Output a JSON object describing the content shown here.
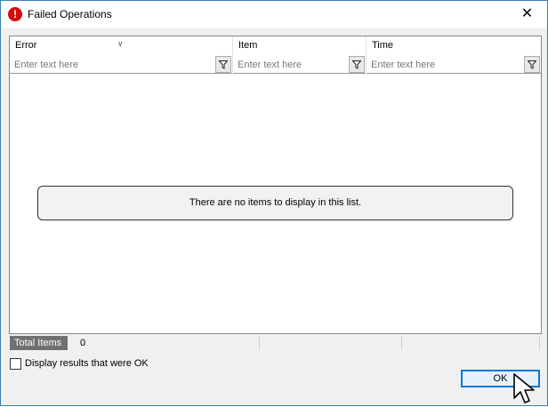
{
  "window": {
    "title": "Failed Operations",
    "title_icon": "error-icon",
    "close_glyph": "✕"
  },
  "grid": {
    "columns": [
      {
        "header": "Error",
        "placeholder": "Enter text here",
        "sorted": true
      },
      {
        "header": "Item",
        "placeholder": "Enter text here"
      },
      {
        "header": "Time",
        "placeholder": "Enter text here"
      }
    ],
    "empty_message": "There are no items to display in this list."
  },
  "status": {
    "total_label": "Total Items",
    "total_value": "0"
  },
  "options": {
    "show_ok_label": "Display results that were OK",
    "show_ok_checked": false
  },
  "buttons": {
    "ok_label": "OK"
  }
}
